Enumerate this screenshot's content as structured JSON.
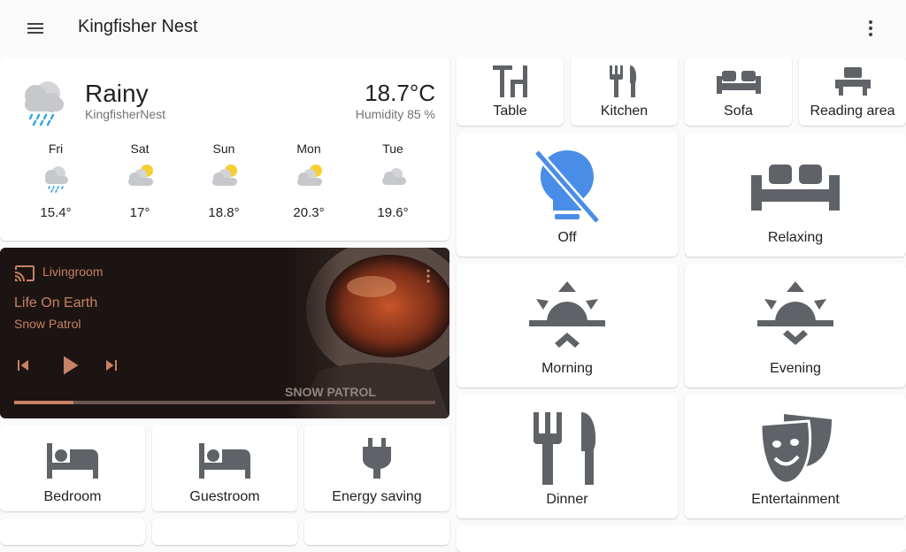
{
  "app": {
    "title": "Kingfisher Nest"
  },
  "weather": {
    "condition": "Rainy",
    "name": "KingfisherNest",
    "temperature": "18.7°C",
    "humidity": "Humidity 85 %",
    "forecast": [
      {
        "day": "Fri",
        "temp": "15.4°",
        "icon": "rainy-icon"
      },
      {
        "day": "Sat",
        "temp": "17°",
        "icon": "partly-cloudy-icon"
      },
      {
        "day": "Sun",
        "temp": "18.8°",
        "icon": "partly-cloudy-icon"
      },
      {
        "day": "Mon",
        "temp": "20.3°",
        "icon": "partly-cloudy-icon"
      },
      {
        "day": "Tue",
        "temp": "19.6°",
        "icon": "cloudy-icon"
      }
    ]
  },
  "media": {
    "source": "Livingroom",
    "title": "Life On Earth",
    "artist": "Snow Patrol",
    "art_text": "SNOW PATROL",
    "progress": 0.14,
    "accent": "#c58264"
  },
  "tiles": {
    "table": "Table",
    "kitchen": "Kitchen",
    "sofa": "Sofa",
    "reading_area": "Reading area",
    "off": "Off",
    "relaxing": "Relaxing",
    "morning": "Morning",
    "evening": "Evening",
    "dinner": "Dinner",
    "entertainment": "Entertainment",
    "bedroom": "Bedroom",
    "guestroom": "Guestroom",
    "energy_saving": "Energy saving"
  },
  "colors": {
    "icon": "#5f6368",
    "light_off": "#4a8de8"
  }
}
